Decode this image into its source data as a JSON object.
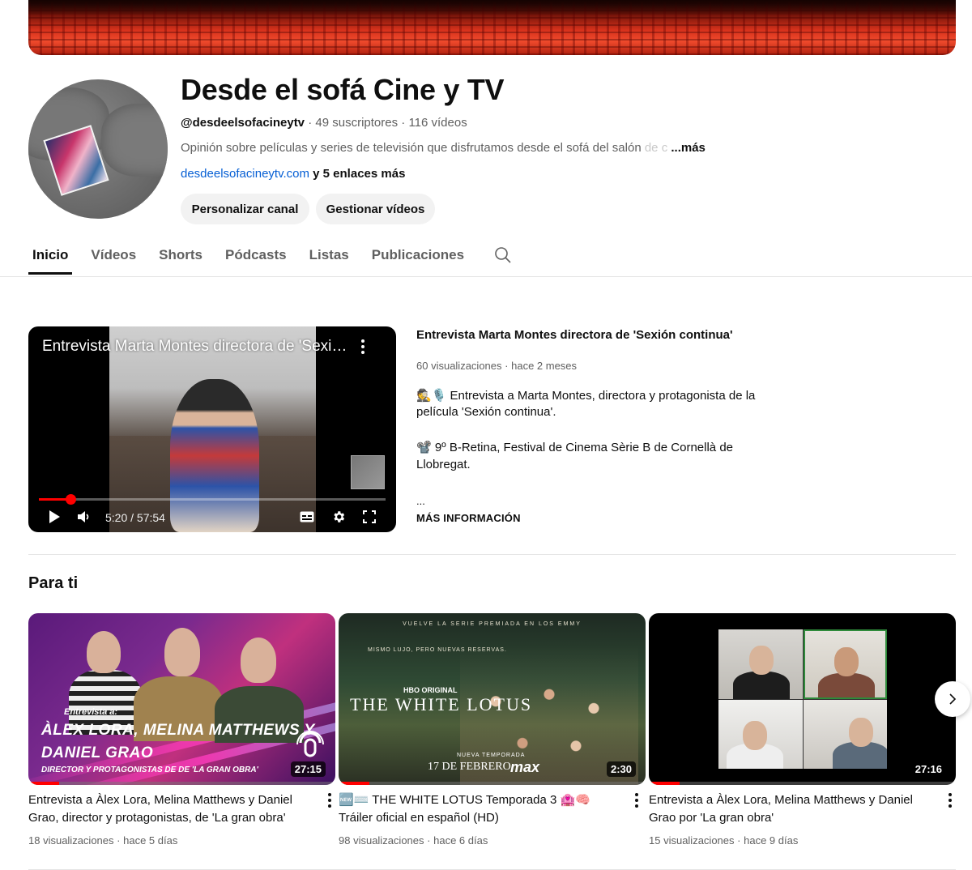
{
  "channel": {
    "name": "Desde el sofá Cine y TV",
    "handle": "@desdeelsofacineytv",
    "subscribers": "49 suscriptores",
    "videos_count": "116 vídeos",
    "description": "Opinión sobre películas y series de televisión que disfrutamos desde el sofá del salón",
    "description_fade": " de c",
    "more_label": "...más",
    "link": "desdeelsofacineytv.com",
    "more_links": "y 5 enlaces más",
    "separator": "·"
  },
  "buttons": {
    "customize": "Personalizar canal",
    "manage": "Gestionar vídeos"
  },
  "tabs": [
    "Inicio",
    "Vídeos",
    "Shorts",
    "Pódcasts",
    "Listas",
    "Publicaciones"
  ],
  "icons": {
    "search": "search-icon",
    "menu": "more-vert-icon",
    "play": "play-icon",
    "volume": "volume-icon",
    "subtitles": "subtitles-icon",
    "settings": "gear-icon",
    "fullscreen": "fullscreen-icon",
    "next": "chevron-right-icon"
  },
  "featured": {
    "player_title": "Entrevista Marta Montes directora de 'Sexión continua'",
    "time": "5:20 / 57:54",
    "progress_fraction": 0.092,
    "title": "Entrevista Marta Montes directora de 'Sexión continua'",
    "views": "60 visualizaciones",
    "age": "hace 2 meses",
    "desc_line1": "🕵️🎙️ Entrevista a Marta Montes, directora y protagonista de la",
    "desc_line2": "película 'Sexión continua'.",
    "desc_line3": "📽️ 9º B-Retina, Festival de Cinema Sèrie B de Cornellà de",
    "desc_line4": "Llobregat.",
    "desc_ellipsis": "...",
    "more_info": "MÁS INFORMACIÓN"
  },
  "section_title": "Para ti",
  "cards": [
    {
      "title": "Entrevista a Àlex Lora, Melina Matthews y Daniel Grao, director y protagonistas, de 'La gran obra'",
      "views": "18 visualizaciones",
      "age": "hace 5 días",
      "duration": "27:15",
      "watched_fraction": 0.1,
      "thumb_cap1": "Entrevista a:",
      "thumb_cap2": "ÀLEX LORA, MELINA MATTHEWS Y",
      "thumb_cap3": "DANIEL GRAO",
      "thumb_cap4": "DIRECTOR Y PROTAGONISTAS DE  DE 'LA GRAN OBRA'"
    },
    {
      "title": "🆕⌨️ THE WHITE LOTUS Temporada 3 🏩🧠 Tráiler oficial en español (HD)",
      "views": "98 visualizaciones",
      "age": "hace 6 días",
      "duration": "2:30",
      "watched_fraction": 0.1,
      "thumb_top": "VUELVE LA SERIE PREMIADA EN LOS EMMY",
      "thumb_sub": "MISMO LUJO, PERO NUEVAS RESERVAS.",
      "thumb_hbo": "HBO ORIGINAL",
      "thumb_big": "THE WHITE LOTUS",
      "thumb_nueva": "NUEVA TEMPORADA",
      "thumb_fecha": "17 DE FEBRERO",
      "thumb_max": "max"
    },
    {
      "title": "Entrevista a Àlex Lora, Melina Matthews y Daniel Grao por 'La gran obra'",
      "views": "15 visualizaciones",
      "age": "hace 9 días",
      "duration": "27:16",
      "watched_fraction": 0.1
    }
  ]
}
